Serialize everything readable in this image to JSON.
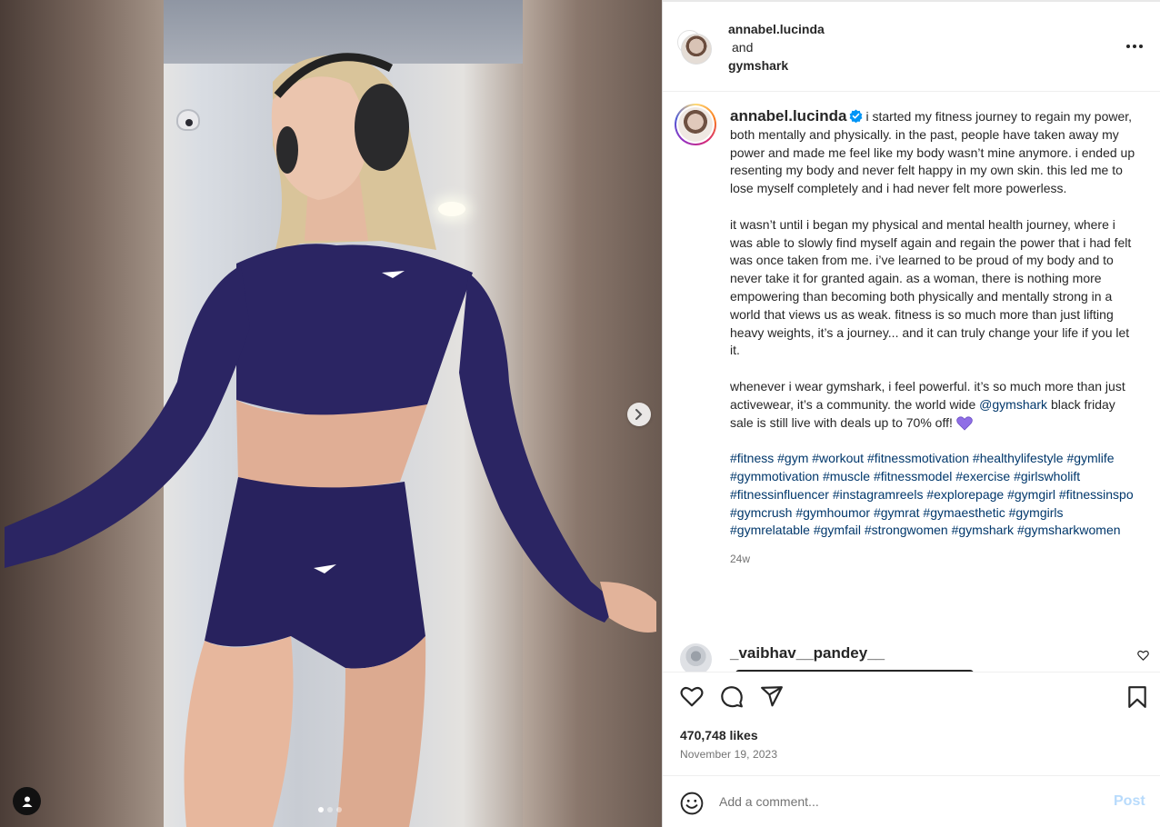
{
  "media": {
    "slide_count": 3,
    "active_slide": 1
  },
  "header": {
    "user1": "annabel.lucinda",
    "conjunction": "and",
    "user2": "gymshark"
  },
  "caption": {
    "author": "annabel.lucinda",
    "paragraph1": "i started my fitness journey to regain my power, both mentally and physically. in the past, people have taken away my power and made me feel like my body wasn’t mine anymore. i ended up resenting my body and never felt happy in my own skin. this led me to lose myself completely and i had never felt more powerless.",
    "paragraph2": "it wasn’t until i began my physical and mental health journey, where i was able to slowly find myself again and regain the power that i had felt was once taken from me. i’ve learned to be proud of my body and to never take it for granted again. as a woman, there is nothing more empowering than becoming both physically and mentally strong in a world that views us as weak. fitness is so much more than just lifting heavy weights, it’s a journey... and it can truly change your life if you let it.",
    "paragraph3_before": "whenever i wear gymshark, i feel powerful. it’s so much more than just activewear, it’s a community. the world wide",
    "mention": "@gymshark",
    "paragraph3_after": "black friday sale is still live with deals up to 70% off!",
    "hashtags": [
      "#fitness",
      "#gym",
      "#workout",
      "#fitnessmotivation",
      "#healthylifestyle",
      "#gymlife",
      "#gymmotivation",
      "#muscle",
      "#fitnessmodel",
      "#exercise",
      "#girlswholift",
      "#fitnessinfluencer",
      "#instagramreels",
      "#explorepage",
      "#gymgirl",
      "#fitnessinspo",
      "#gymcrush",
      "#gymhoumor",
      "#gymrat",
      "#gymaesthetic",
      "#gymgirls",
      "#gymrelatable",
      "#gymfail",
      "#strongwomen",
      "#gymshark",
      "#gymsharkwomen"
    ],
    "time_ago": "24w"
  },
  "comment": {
    "username": "_vaibhav__pandey__"
  },
  "stats": {
    "likes": "470,748 likes",
    "date": "November 19, 2023"
  },
  "composer": {
    "placeholder": "Add a comment...",
    "post_label": "Post"
  },
  "colors": {
    "link": "#00376b",
    "post_button_disabled": "#b8dbfc",
    "outfit": "#2b2563",
    "heart_emoji": "#8f6ee6",
    "verified": "#0095f6"
  }
}
